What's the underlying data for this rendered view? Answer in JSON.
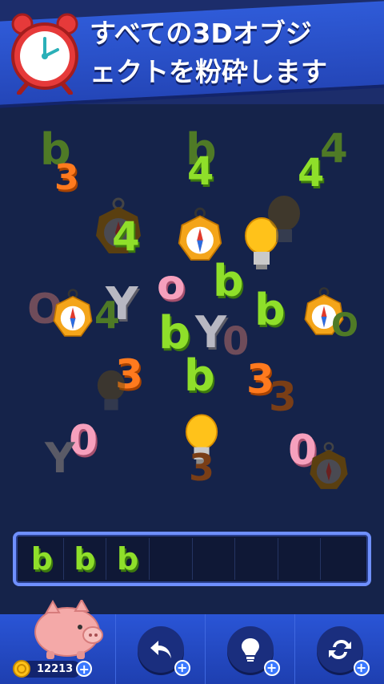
{
  "banner": {
    "line1": "すべての3Dオブジ",
    "line2": "ェクトを粉砕します"
  },
  "board": {
    "pieces": [
      {
        "text": "b",
        "color": "green",
        "dim": true
      },
      {
        "text": "3",
        "color": "orange"
      },
      {
        "text": "b",
        "color": "green",
        "dim": true
      },
      {
        "text": "4",
        "color": "green"
      },
      {
        "text": "4",
        "color": "green",
        "dim": true
      },
      {
        "text": "4",
        "color": "green"
      },
      {
        "text": "4",
        "color": "green"
      },
      {
        "text": "o",
        "color": "pink"
      },
      {
        "text": "b",
        "color": "green"
      },
      {
        "text": "O",
        "color": "pink",
        "dim": true
      },
      {
        "text": "Y",
        "color": "grey"
      },
      {
        "text": "4",
        "color": "green",
        "dim": true
      },
      {
        "text": "b",
        "color": "green"
      },
      {
        "text": "b",
        "color": "green"
      },
      {
        "text": "Y",
        "color": "grey"
      },
      {
        "text": "0",
        "color": "pink",
        "dim": true
      },
      {
        "text": "3",
        "color": "orange"
      },
      {
        "text": "b",
        "color": "green"
      },
      {
        "text": "3",
        "color": "orange"
      },
      {
        "text": "3",
        "color": "orange",
        "dim": true
      },
      {
        "text": "0",
        "color": "pink"
      },
      {
        "text": "Y",
        "color": "grey",
        "dim": true
      },
      {
        "text": "0",
        "color": "pink"
      },
      {
        "text": "3",
        "color": "orange",
        "dim": true
      },
      {
        "text": "O",
        "color": "green",
        "dim": true
      }
    ]
  },
  "tray": {
    "slots": [
      "b",
      "b",
      "b",
      "",
      "",
      "",
      "",
      ""
    ]
  },
  "bottom": {
    "coins": "12213",
    "tools": [
      {
        "icon": "undo-icon"
      },
      {
        "icon": "lightbulb-icon"
      },
      {
        "icon": "shuffle-icon"
      }
    ]
  },
  "colors": {
    "background": "#15234a",
    "banner": "#2f5bd8",
    "green": "#8fdf2a",
    "orange": "#ff7a1e",
    "pink": "#f6a0bd",
    "tray_border": "#6f90ff"
  }
}
